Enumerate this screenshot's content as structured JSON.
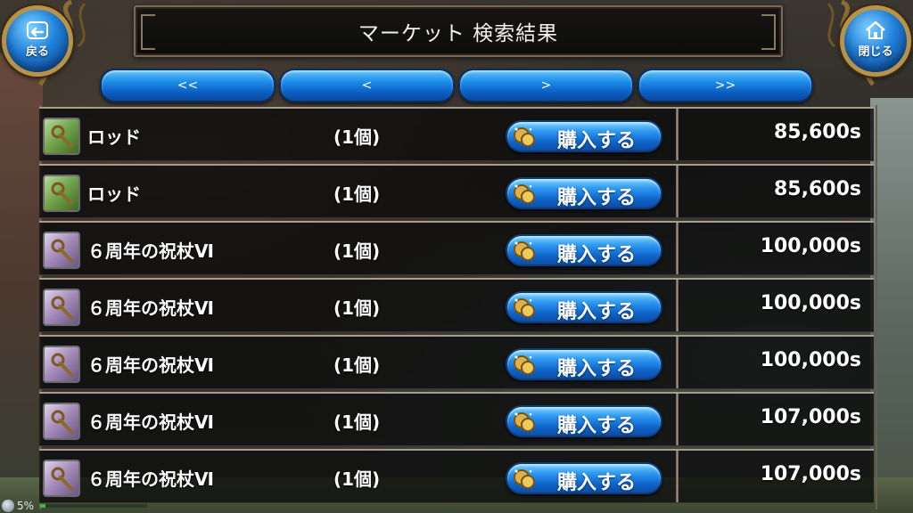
{
  "header": {
    "title": "マーケット 検索結果",
    "back_label": "戻る",
    "close_label": "閉じる"
  },
  "pager": {
    "first": "<<",
    "prev": "<",
    "next": ">",
    "last": ">>"
  },
  "buy_label": "購入する",
  "items": [
    {
      "name": "ロッド",
      "qty": "(1個)",
      "price": "85,600s",
      "icon": "green-rod-icon"
    },
    {
      "name": "ロッド",
      "qty": "(1個)",
      "price": "85,600s",
      "icon": "green-rod-icon"
    },
    {
      "name": "６周年の祝杖Ⅵ",
      "qty": "(1個)",
      "price": "100,000s",
      "icon": "purple-staff-icon"
    },
    {
      "name": "６周年の祝杖Ⅵ",
      "qty": "(1個)",
      "price": "100,000s",
      "icon": "purple-staff-icon"
    },
    {
      "name": "６周年の祝杖Ⅵ",
      "qty": "(1個)",
      "price": "100,000s",
      "icon": "purple-staff-icon"
    },
    {
      "name": "６周年の祝杖Ⅵ",
      "qty": "(1個)",
      "price": "107,000s",
      "icon": "purple-staff-icon"
    },
    {
      "name": "６周年の祝杖Ⅵ",
      "qty": "(1個)",
      "price": "107,000s",
      "icon": "purple-staff-icon"
    }
  ],
  "status": {
    "battery": "5%",
    "battery_level": 0.05
  },
  "colors": {
    "button_blue": "#1a8ae8",
    "frame_gold": "#b7924a"
  }
}
